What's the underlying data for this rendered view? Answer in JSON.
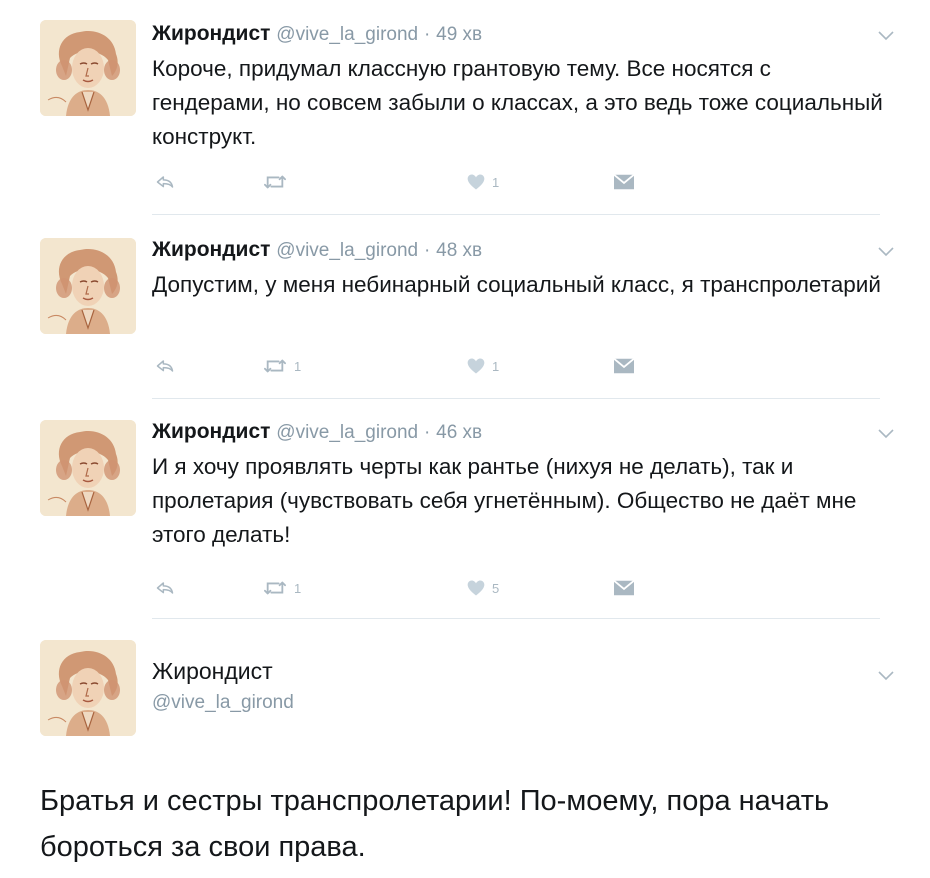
{
  "tweets": [
    {
      "name": "Жирондист",
      "handle": "@vive_la_girond",
      "separator": "·",
      "time": "49 хв",
      "text": "Короче, придумал классную грантовую тему. Все носятся с гендерами, но совсем забыли о классах, а это ведь тоже социальный конструкт.",
      "retweets": "",
      "likes": "1"
    },
    {
      "name": "Жирондист",
      "handle": "@vive_la_girond",
      "separator": "·",
      "time": "48 хв",
      "text": "Допустим, у меня небинарный социальный класс, я транспролетарий",
      "retweets": "1",
      "likes": "1"
    },
    {
      "name": "Жирондист",
      "handle": "@vive_la_girond",
      "separator": "·",
      "time": "46 хв",
      "text": "И я хочу проявлять черты как рантье (нихуя не делать), так и пролетария (чувствовать себя угнетённым). Общество не даёт мне этого делать!",
      "retweets": "1",
      "likes": "5"
    }
  ],
  "detail": {
    "name": "Жирондист",
    "handle": "@vive_la_girond",
    "text": "Братья и сестры транспролетарии! По-моему, пора начать бороться за свои права."
  },
  "colors": {
    "text": "#14171a",
    "muted": "#8899a6",
    "icon": "#aab8c2",
    "divider": "#e1e8ed"
  },
  "icons": [
    "reply-icon",
    "retweet-icon",
    "like-icon",
    "direct-message-icon",
    "chevron-down-icon",
    "avatar-portrait"
  ]
}
